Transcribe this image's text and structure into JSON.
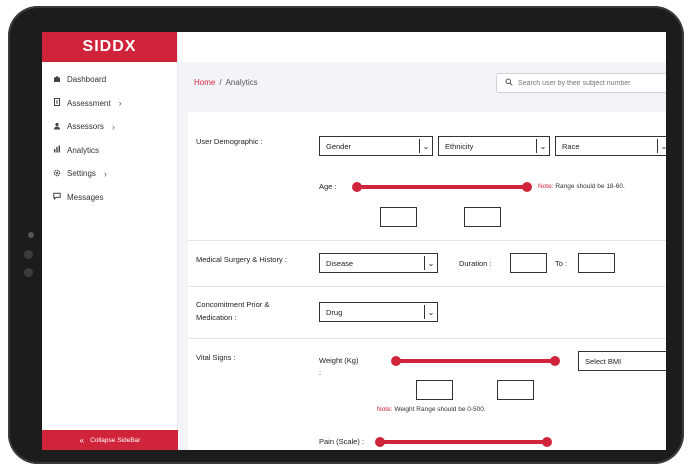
{
  "sidebar": {
    "logo": "SIDDX",
    "items": [
      {
        "icon": "dashboard-icon",
        "label": "Dashboard",
        "has_chevron": false
      },
      {
        "icon": "assessment-icon",
        "label": "Assessment",
        "has_chevron": true
      },
      {
        "icon": "assessors-icon",
        "label": "Assessors",
        "has_chevron": true
      },
      {
        "icon": "analytics-icon",
        "label": "Analytics",
        "has_chevron": false
      },
      {
        "icon": "settings-icon",
        "label": "Settings",
        "has_chevron": true
      },
      {
        "icon": "messages-icon",
        "label": "Messages",
        "has_chevron": false
      }
    ],
    "collapse_label": "Collapse SideBar"
  },
  "header": {
    "breadcrumb_home": "Home",
    "breadcrumb_sep": "/",
    "breadcrumb_current": "Analytics",
    "search_placeholder": "Search user by their subject number"
  },
  "form": {
    "demographic": {
      "label": "User Demographic :",
      "gender": "Gender",
      "ethnicity": "Ethnicity",
      "race": "Race",
      "age_label": "Age :",
      "note_prefix": "Note:",
      "note_text": "Range should be 18-60."
    },
    "medical": {
      "label": "Medical Surgery & History :",
      "disease": "Disease",
      "duration_label": "Duration :",
      "to_label": "To :"
    },
    "concomitment": {
      "label_line1": "Concomitment Prior &",
      "label_line2": "Medication :",
      "drug": "Drug"
    },
    "vitals": {
      "label": "Vital Signs :",
      "weight_label": "Weight (Kg)",
      "weight_colon": ":",
      "bmi": "Select BMI",
      "note_prefix": "Note:",
      "note_text": "Weight Range should be 0-500.",
      "pain_label": "Pain (Scale) :"
    }
  },
  "colors": {
    "accent": "#d0243a",
    "background": "#f2f4f8"
  }
}
